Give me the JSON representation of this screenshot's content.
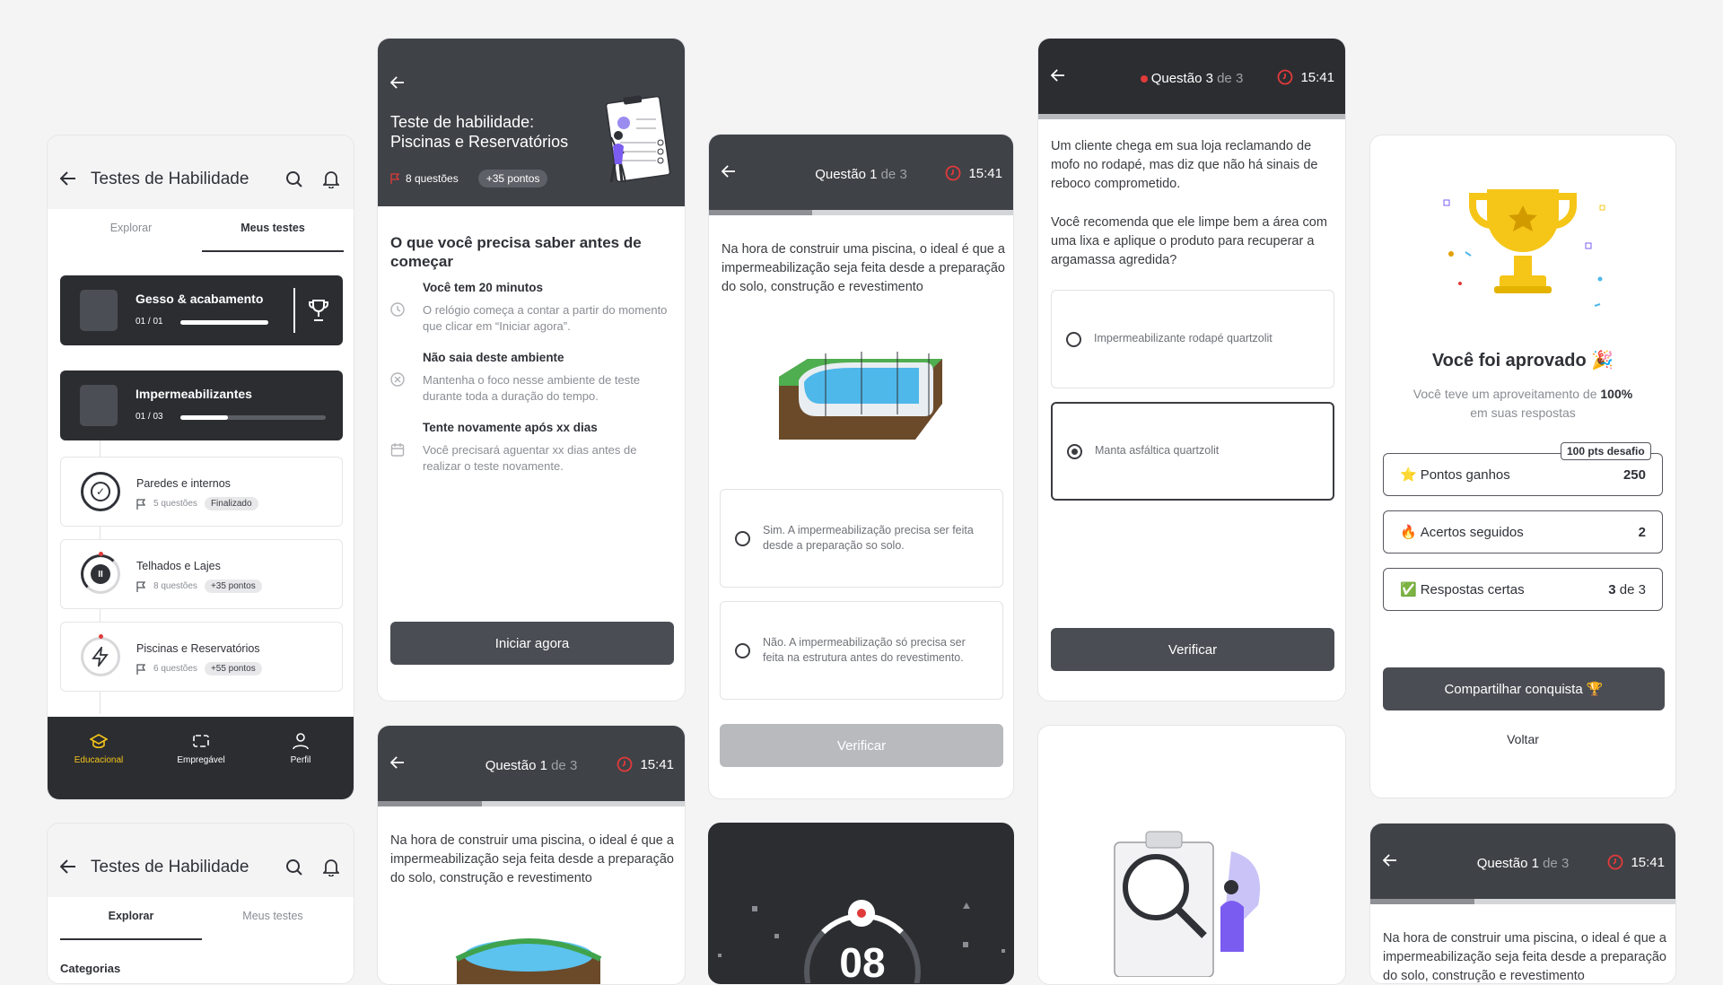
{
  "list_screen": {
    "title": "Testes de Habilidade",
    "tabs": [
      "Explorar",
      "Meus testes"
    ],
    "active_tab": "Meus testes",
    "dark_items": [
      {
        "title": "Gesso & acabamento",
        "count": "01 / 01",
        "progress": 1.0
      },
      {
        "title": "Impermeabilizantes",
        "count": "01 / 03",
        "progress": 0.33
      }
    ],
    "sub_items": [
      {
        "title": "Paredes e internos",
        "questions": "5 questões",
        "badge": "Finalizado"
      },
      {
        "title": "Telhados e Lajes",
        "questions": "8 questões",
        "badge": "+35 pontos"
      },
      {
        "title": "Piscinas e Reservatórios",
        "questions": "6 questões",
        "badge": "+55 pontos"
      }
    ],
    "nav": [
      {
        "label": "Educacional",
        "icon": "graduation-cap-icon",
        "active": true
      },
      {
        "label": "Empregável",
        "icon": "id-card-icon",
        "active": false
      },
      {
        "label": "Perfil",
        "icon": "user-icon",
        "active": false
      }
    ]
  },
  "list_screen2": {
    "title": "Testes de Habilidade",
    "tabs": [
      "Explorar",
      "Meus testes"
    ],
    "active_tab": "Explorar",
    "section": "Categorias"
  },
  "intro_screen": {
    "title_line1": "Teste de habilidade:",
    "title_line2": "Piscinas e Reservatórios",
    "questions": "8 questões",
    "points": "+35 pontos",
    "heading": "O que você precisa saber antes de começar",
    "rules": [
      {
        "icon": "clock-icon",
        "title": "Você tem 20 minutos",
        "text": "O relógio começa a contar a partir do momento que clicar em “Iniciar agora”."
      },
      {
        "icon": "x-circle-icon",
        "title": "Não saia deste ambiente",
        "text": "Mantenha o foco nesse ambiente de teste durante toda a duração do tempo."
      },
      {
        "icon": "calendar-icon",
        "title": "Tente novamente após xx dias",
        "text": "Você precisará aguentar xx dias antes de realizar o teste novamente."
      }
    ],
    "start_button": "Iniciar agora"
  },
  "question1": {
    "header_main": "Questão 1",
    "header_sub": "de 3",
    "timer": "15:41",
    "text": "Na hora de construir uma piscina, o ideal é que a impermeabilização seja feita desde a preparação do solo, construção e revestimento",
    "options": [
      "Sim. A impermeabilização precisa ser feita desde a preparação so solo.",
      "Não. A impermeabilização só precisa ser feita na estrutura antes do revestimento."
    ],
    "verify_button": "Verificar"
  },
  "question3": {
    "header_main": "Questão 3",
    "header_sub": "de 3",
    "timer": "15:41",
    "text1": "Um cliente chega em sua loja reclamando de mofo no rodapé, mas diz que não há sinais de reboco comprometido.",
    "text2": "Você recomenda que ele limpe bem a área com uma lixa e aplique o produto para recuperar a argamassa agredida?",
    "options": [
      "Impermeabilizante rodapé quartzolit",
      "Manta asfáltica quartzolit"
    ],
    "selected_option": 1,
    "verify_button": "Verificar"
  },
  "result": {
    "title": "Você foi aprovado",
    "title_emoji": "🎉",
    "text_part1": "Você teve um aproveitamento de",
    "text_bold": "100%",
    "text_part2": "em suas respostas",
    "badge": "100 pts desafio",
    "stats": [
      {
        "emoji": "⭐",
        "label": "Pontos ganhos",
        "value": "250"
      },
      {
        "emoji": "🔥",
        "label": "Acertos seguidos",
        "value": "2"
      },
      {
        "emoji": "✅",
        "label": "Respostas certas",
        "value": "3",
        "value_sub": "de 3"
      }
    ],
    "share_button": "Compartilhar conquista",
    "share_emoji": "🏆",
    "back_link": "Voltar"
  },
  "countdown": {
    "value": "08"
  },
  "colors": {
    "accent_yellow": "#f5c518",
    "timer_red": "#e03a3a",
    "dark": "#3f4247"
  }
}
